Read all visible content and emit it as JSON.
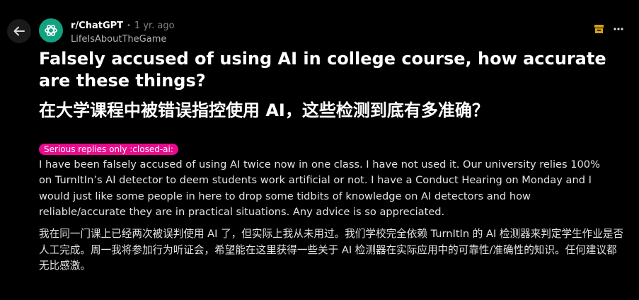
{
  "header": {
    "back_icon": "arrow-left-icon",
    "subreddit_icon": "openai-logo-icon",
    "subreddit": "r/ChatGPT",
    "separator": "•",
    "age": "1 yr. ago",
    "author": "LifeIsAboutTheGame",
    "award_icon": "award-icon",
    "more_icon": "more-options-icon",
    "award_color": "#d4a017"
  },
  "post": {
    "title_en": "Falsely accused of using AI in college course, how accurate are these things?",
    "title_zh": "在大学课程中被错误指控使用 AI，这些检测到底有多准确？",
    "flair": "Serious replies only :closed-ai:",
    "flair_color": "#ea0a8e",
    "body_en": "I have been falsely accused of using AI twice now in one class. I have not used it. Our university relies 100% on TurnItIn’s AI detector to deem students work artificial or not. I have a Conduct Hearing on Monday and I would just like some people in here to drop some tidbits of knowledge on AI detectors and how reliable/accurate they are in practical situations. Any advice is so appreciated.",
    "body_zh": "我在同一门课上已经两次被误判使用 AI 了，但实际上我从未用过。我们学校完全依赖 TurnItIn 的 AI 检测器来判定学生作业是否人工完成。周一我将参加行为听证会，希望能在这里获得一些关于 AI 检测器在实际应用中的可靠性/准确性的知识。任何建议都无比感激。"
  }
}
